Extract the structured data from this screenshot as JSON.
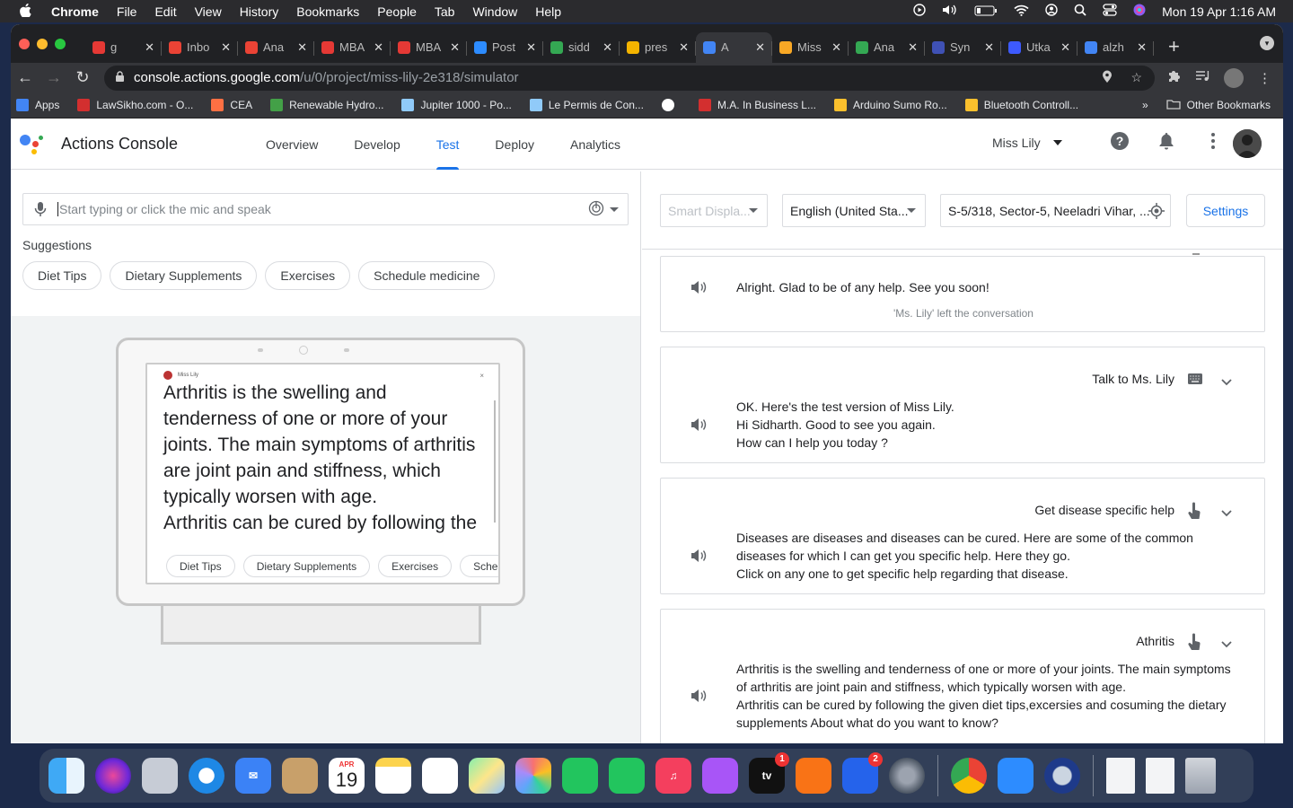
{
  "mac_menubar": {
    "apple": "",
    "app": "Chrome",
    "menus": [
      "File",
      "Edit",
      "View",
      "History",
      "Bookmarks",
      "People",
      "Tab",
      "Window",
      "Help"
    ],
    "clock": "Mon 19 Apr  1:16 AM"
  },
  "tabs": [
    {
      "title": "g",
      "color": "#e53935"
    },
    {
      "title": "Inbo",
      "color": "#ea4335"
    },
    {
      "title": "Ana",
      "color": "#ea4335"
    },
    {
      "title": "MBA",
      "color": "#e53935"
    },
    {
      "title": "MBA",
      "color": "#e53935"
    },
    {
      "title": "Post",
      "color": "#2d8cff"
    },
    {
      "title": "sidd",
      "color": "#34a853"
    },
    {
      "title": "pres",
      "color": "#f4b400"
    },
    {
      "title": "A",
      "color": "#4285f4"
    },
    {
      "title": "Miss",
      "color": "#f9a825"
    },
    {
      "title": "Ana",
      "color": "#34a853"
    },
    {
      "title": "Syn",
      "color": "#3f51b5"
    },
    {
      "title": "Utka",
      "color": "#3d5afe"
    },
    {
      "title": "alzh",
      "color": "#4285f4"
    }
  ],
  "omnibox": {
    "host": "console.actions.google.com",
    "path": "/u/0/project/miss-lily-2e318/simulator"
  },
  "bookmarks": [
    {
      "label": "Apps",
      "color": "#4285f4"
    },
    {
      "label": "LawSikho.com - O...",
      "color": "#d32f2f"
    },
    {
      "label": "CEA",
      "color": "#ff7043"
    },
    {
      "label": "Renewable Hydro...",
      "color": "#43a047"
    },
    {
      "label": "Jupiter 1000 - Po...",
      "color": "#90caf9"
    },
    {
      "label": "Le Permis de Con...",
      "color": "#90caf9"
    },
    {
      "label": "",
      "color": "#ffffff"
    },
    {
      "label": "M.A. In Business L...",
      "color": "#d32f2f"
    },
    {
      "label": "Arduino Sumo Ro...",
      "color": "#fbc02d"
    },
    {
      "label": "Bluetooth Controll...",
      "color": "#fbc02d"
    }
  ],
  "bookmarks_overflow": "»",
  "other_bookmarks": "Other Bookmarks",
  "app": {
    "title": "Actions Console",
    "nav": [
      "Overview",
      "Develop",
      "Test",
      "Deploy",
      "Analytics"
    ],
    "active_nav": "Test",
    "project": "Miss Lily"
  },
  "input": {
    "placeholder": "Start typing or click the mic and speak"
  },
  "suggestions_title": "Suggestions",
  "suggestions": [
    "Diet Tips",
    "Dietary Supplements",
    "Exercises",
    "Schedule medicine"
  ],
  "device": {
    "header_name": "Miss Lily",
    "close": "×",
    "text": "Arthritis is the swelling and tenderness of one or more of your joints. The main symptoms of arthritis are joint pain and stiffness, which typically worsen with age.\nArthritis can be cured by following the",
    "chips": [
      "Diet Tips",
      "Dietary Supplements",
      "Exercises",
      "Sche"
    ]
  },
  "controls": {
    "surface": "Smart Displa...",
    "language": "English (United Sta...",
    "location": "S-5/318, Sector-5, Neeladri Vihar, ...",
    "settings": "Settings"
  },
  "conversation": [
    {
      "label": "",
      "body": "Alright. Glad to be of any help. See you soon!",
      "note": "'Ms. Lily' left the conversation"
    },
    {
      "label": "Talk to Ms. Lily",
      "input_icon": "keyboard-icon",
      "body": "OK. Here's the test version of Miss Lily.\nHi Sidharth. Good to see you again.\nHow can I help you today ?"
    },
    {
      "label": "Get disease specific help",
      "input_icon": "touch-icon",
      "body": "Diseases are diseases and diseases can be cured. Here are some of the common\ndiseases for which I can get you specific help. Here they go.\nClick on any one to get specific help regarding that disease."
    },
    {
      "label": "Athritis",
      "input_icon": "touch-icon",
      "body": "Arthritis is the swelling and tenderness of one or more of your joints. The main symptoms\nof arthritis are joint pain and stiffness, which typically worsen with age.\nArthritis can be cured by following the given diet tips,excersies and cosuming the dietary\nsupplements About what do you want to know?"
    }
  ],
  "dock": {
    "calendar_month": "APR",
    "calendar_day": "19",
    "tv_badge": "1",
    "appstore_badge": "2",
    "tv_label": "tv"
  }
}
